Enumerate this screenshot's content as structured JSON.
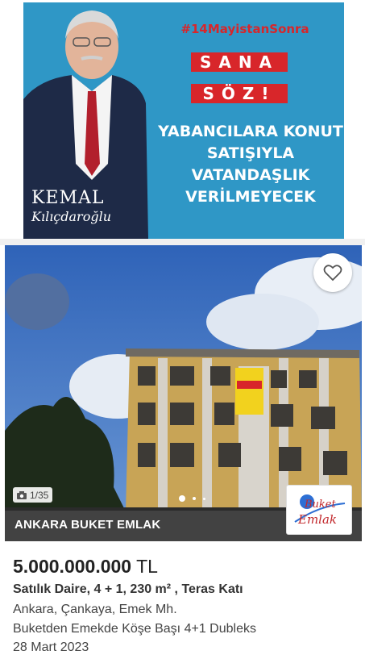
{
  "banner": {
    "hashtag": "#14MayistanSonra",
    "headline_1": "SANA",
    "headline_2": "SÖZ!",
    "promise_1": "YABANCILARA KONUT",
    "promise_2": "SATIŞIYLA",
    "promise_3": "VATANDAŞLIK",
    "promise_4": "VERİLMEYECEK",
    "signature_1": "KEMAL",
    "signature_2": "Kılıçdaroğlu",
    "colors": {
      "background": "#2f97c6",
      "accent": "#d8262a"
    }
  },
  "listing": {
    "photo_counter": "1/35",
    "agency_name": "ANKARA BUKET EMLAK",
    "agency_logo_1": "Buket",
    "agency_logo_2": "Emlak",
    "price_amount": "5.000.000.000",
    "price_currency": "TL",
    "title": "Satılık Daire, 4 + 1, 230 m² , Teras Katı",
    "location": "Ankara, Çankaya, Emek Mh.",
    "description": "Buketden Emekde Köşe Başı 4+1 Dubleks",
    "date": "28 Mart 2023"
  },
  "icons": {
    "favorite": "heart-icon",
    "camera": "camera-icon"
  }
}
